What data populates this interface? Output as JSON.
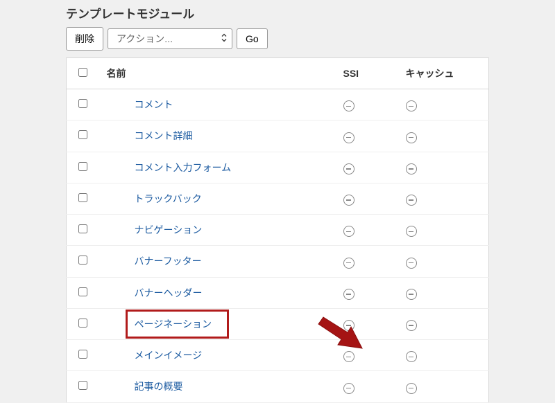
{
  "heading": "テンプレートモジュール",
  "toolbar": {
    "delete_label": "削除",
    "action_select": "アクション...",
    "go_label": "Go"
  },
  "columns": {
    "name": "名前",
    "ssi": "SSI",
    "cache": "キャッシュ"
  },
  "rows": [
    {
      "name": "コメント",
      "highlighted": false
    },
    {
      "name": "コメント詳細",
      "highlighted": false
    },
    {
      "name": "コメント入力フォーム",
      "highlighted": false
    },
    {
      "name": "トラックバック",
      "highlighted": false
    },
    {
      "name": "ナビゲーション",
      "highlighted": false
    },
    {
      "name": "バナーフッター",
      "highlighted": false
    },
    {
      "name": "バナーヘッダー",
      "highlighted": false
    },
    {
      "name": "ページネーション",
      "highlighted": true
    },
    {
      "name": "メインイメージ",
      "highlighted": false
    },
    {
      "name": "記事の概要",
      "highlighted": false
    }
  ]
}
